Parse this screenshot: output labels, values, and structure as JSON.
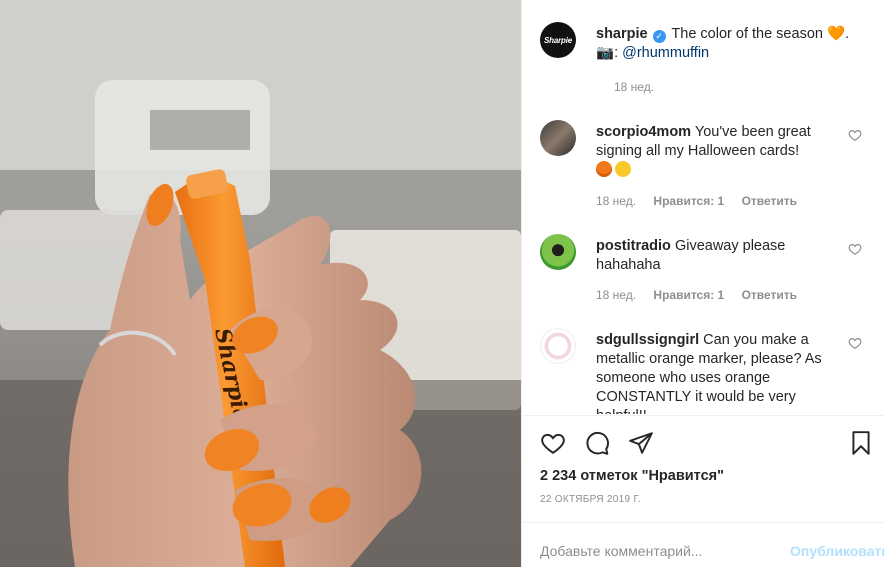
{
  "post": {
    "author": "sharpie",
    "author_avatar_text": "Sharpie",
    "caption_text": "The color of the season",
    "caption_emoji": "🧡",
    "caption_period": ".",
    "camera_emoji": "📷",
    "colon": ":",
    "mention": "@rhummuffin",
    "time": "18 нед."
  },
  "comments": [
    {
      "user": "scorpio4mom",
      "text": "You've been great signing all my Halloween cards!",
      "time": "18 нед.",
      "likes": "Нравится: 1",
      "reply": "Ответить"
    },
    {
      "user": "postitradio",
      "text": "Giveaway please hahahaha",
      "time": "18 нед.",
      "likes": "Нравится: 1",
      "reply": "Ответить"
    },
    {
      "user": "sdgullssigngirl",
      "text": "Can you make a metallic orange marker, please? As someone who uses orange CONSTANTLY it would be very helpful!!",
      "time": "",
      "likes": "",
      "reply": ""
    }
  ],
  "stats": {
    "likes": "2 234 отметок \"Нравится\"",
    "date": "22 ОКТЯБРЯ 2019 Г."
  },
  "comment_box": {
    "placeholder": "Добавьте комментарий...",
    "publish": "Опубликовать"
  },
  "icons": {
    "like": "heart-icon",
    "comment": "comment-icon",
    "share": "share-icon",
    "save": "bookmark-icon",
    "verified": "verified-badge-icon"
  },
  "colors": {
    "verified": "#3897f0",
    "mention": "#00376b",
    "muted": "#8e8e8e",
    "publish_disabled": "#b2dffc",
    "marker": "#f58b1f"
  }
}
